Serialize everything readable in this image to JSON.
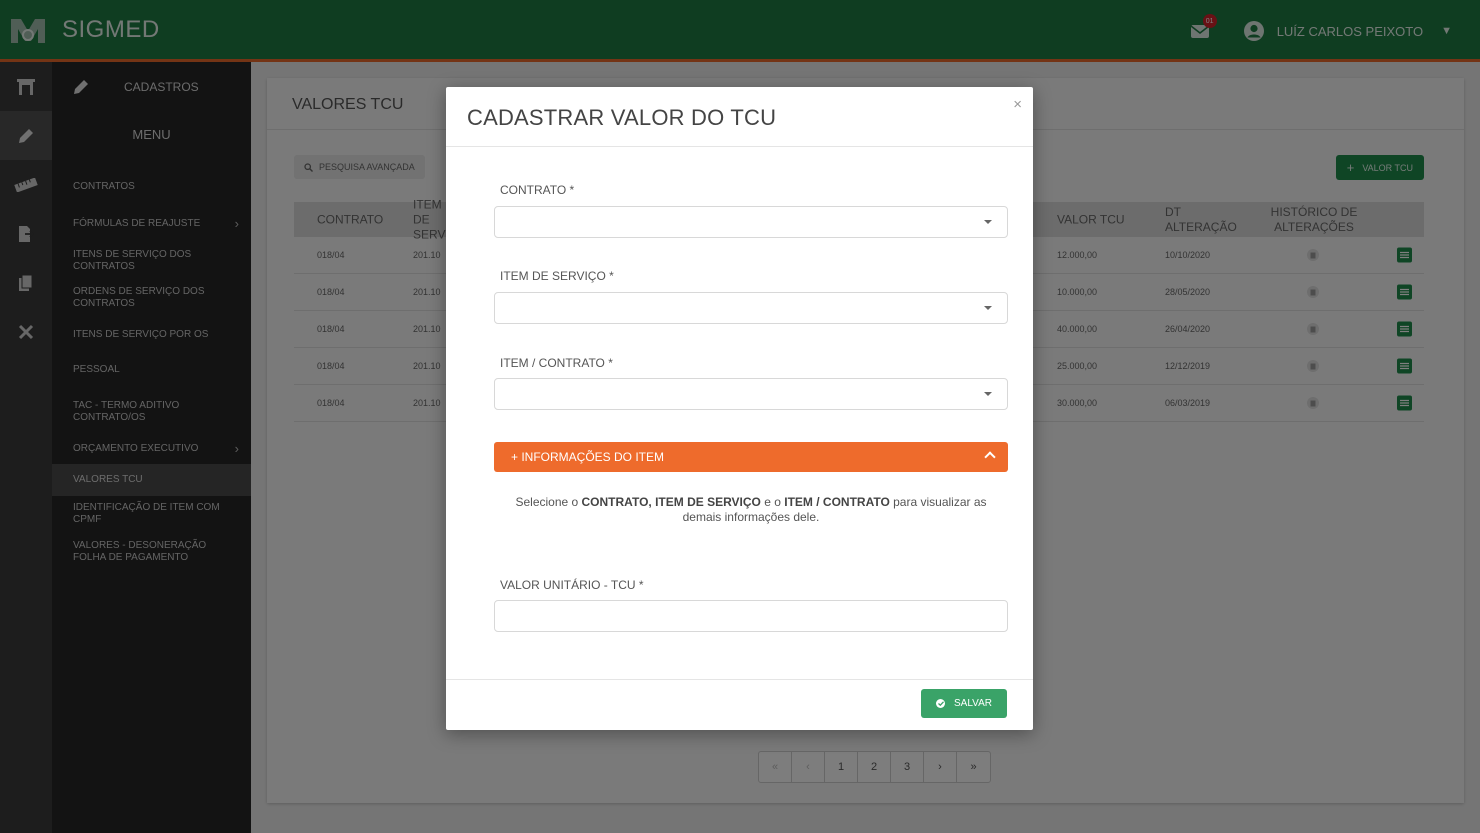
{
  "app": {
    "title": "SIGMED",
    "user_name": "LUÍZ CARLOS PEIXOTO",
    "mail_count": "01"
  },
  "sidemenu": {
    "section_title": "CADASTROS",
    "menu_title": "MENU",
    "items": [
      {
        "label": "CONTRATOS",
        "chevron": false
      },
      {
        "label": "FÓRMULAS DE REAJUSTE",
        "chevron": true
      },
      {
        "label": "ITENS DE SERVIÇO DOS CONTRATOS",
        "chevron": false
      },
      {
        "label": "ORDENS DE SERVIÇO DOS CONTRATOS",
        "chevron": false
      },
      {
        "label": "ITENS DE SERVIÇO POR OS",
        "chevron": false
      },
      {
        "label": "PESSOAL",
        "chevron": false
      },
      {
        "label": "TAC - TERMO ADITIVO CONTRATO/OS",
        "chevron": false
      },
      {
        "label": "ORÇAMENTO EXECUTIVO",
        "chevron": true
      },
      {
        "label": "VALORES TCU",
        "chevron": false,
        "active": true
      },
      {
        "label": "IDENTIFICAÇÃO DE ITEM COM CPMF",
        "chevron": false
      },
      {
        "label": "VALORES - DESONERAÇÃO FOLHA DE PAGAMENTO",
        "chevron": false
      }
    ]
  },
  "page": {
    "title": "VALORES TCU",
    "advanced_search": "PESQUISA AVANÇADA",
    "add_button": "VALOR TCU",
    "table": {
      "headers": {
        "contrato": "CONTRATO",
        "item": "ITEM DE SERVIÇO",
        "valor": "VALOR TCU",
        "dt": "DT ALTERAÇÃO",
        "hist": "HISTÓRICO DE ALTERAÇÕES"
      },
      "rows": [
        {
          "contrato": "018/04",
          "item": "201.10",
          "valor": "12.000,00",
          "dt": "10/10/2020"
        },
        {
          "contrato": "018/04",
          "item": "201.10",
          "valor": "10.000,00",
          "dt": "28/05/2020"
        },
        {
          "contrato": "018/04",
          "item": "201.10",
          "valor": "40.000,00",
          "dt": "26/04/2020"
        },
        {
          "contrato": "018/04",
          "item": "201.10",
          "valor": "25.000,00",
          "dt": "12/12/2019"
        },
        {
          "contrato": "018/04",
          "item": "201.10",
          "valor": "30.000,00",
          "dt": "06/03/2019"
        }
      ]
    },
    "pagination": [
      "«",
      "‹",
      "1",
      "2",
      "3",
      "›",
      "»"
    ]
  },
  "modal": {
    "title": "CADASTRAR VALOR DO TCU",
    "close": "×",
    "contrato_label": "CONTRATO *",
    "item_label": "ITEM DE SERVIÇO *",
    "item_contrato_label": "ITEM / CONTRATO *",
    "accordion_label": "+ INFORMAÇÕES DO ITEM",
    "hint": {
      "p1": "Selecione o ",
      "b1": "CONTRATO, ITEM DE SERVIÇO",
      "p2": " e o ",
      "b2": "ITEM / CONTRATO",
      "p3": " para visualizar as demais informações dele."
    },
    "valor_label": "VALOR UNITÁRIO - TCU *",
    "valor_value": "",
    "save_label": "SALVAR"
  },
  "colors": {
    "primary_green": "#1f7a43",
    "accent_orange": "#ee6b2c",
    "save_green": "#3aa368"
  }
}
